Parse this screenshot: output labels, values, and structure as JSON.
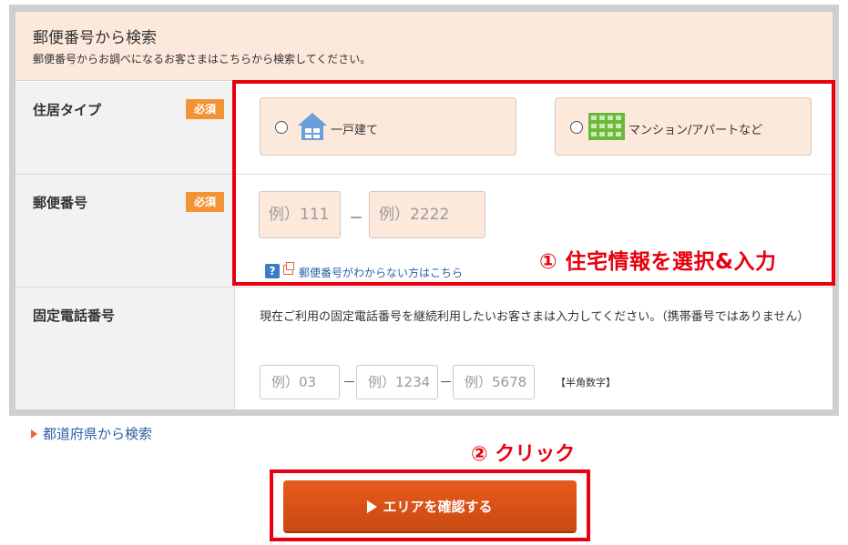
{
  "header": {
    "title": "郵便番号から検索",
    "subtitle": "郵便番号からお調べになるお客さまはこちらから検索してください。"
  },
  "required_badge": "必須",
  "housing_type": {
    "label": "住居タイプ",
    "options": [
      {
        "label": "一戸建て",
        "icon": "house-icon"
      },
      {
        "label": "マンション/アパートなど",
        "icon": "apartment-icon"
      }
    ]
  },
  "postal": {
    "label": "郵便番号",
    "placeholder1": "例）111",
    "placeholder2": "例）2222",
    "separator": "－",
    "help_icon": "?",
    "help_link": "郵便番号がわからない方はこちら"
  },
  "phone": {
    "label": "固定電話番号",
    "description": "現在ご利用の固定電話番号を継続利用したいお客さまは入力してください。（携帯番号ではありません）",
    "placeholder1": "例）03",
    "placeholder2": "例）1234",
    "placeholder3": "例）5678",
    "separator": "－",
    "note": "【半角数字】"
  },
  "prefecture_link": "都道府県から検索",
  "annotations": {
    "step1": "① 住宅情報を選択&入力",
    "step2": "② クリック"
  },
  "confirm_button": "エリアを確認する",
  "colors": {
    "accent_red": "#e8000e",
    "button_orange": "#e05418",
    "peach": "#fde8dc",
    "badge_orange": "#f29436",
    "link_blue": "#2a5fa8"
  }
}
